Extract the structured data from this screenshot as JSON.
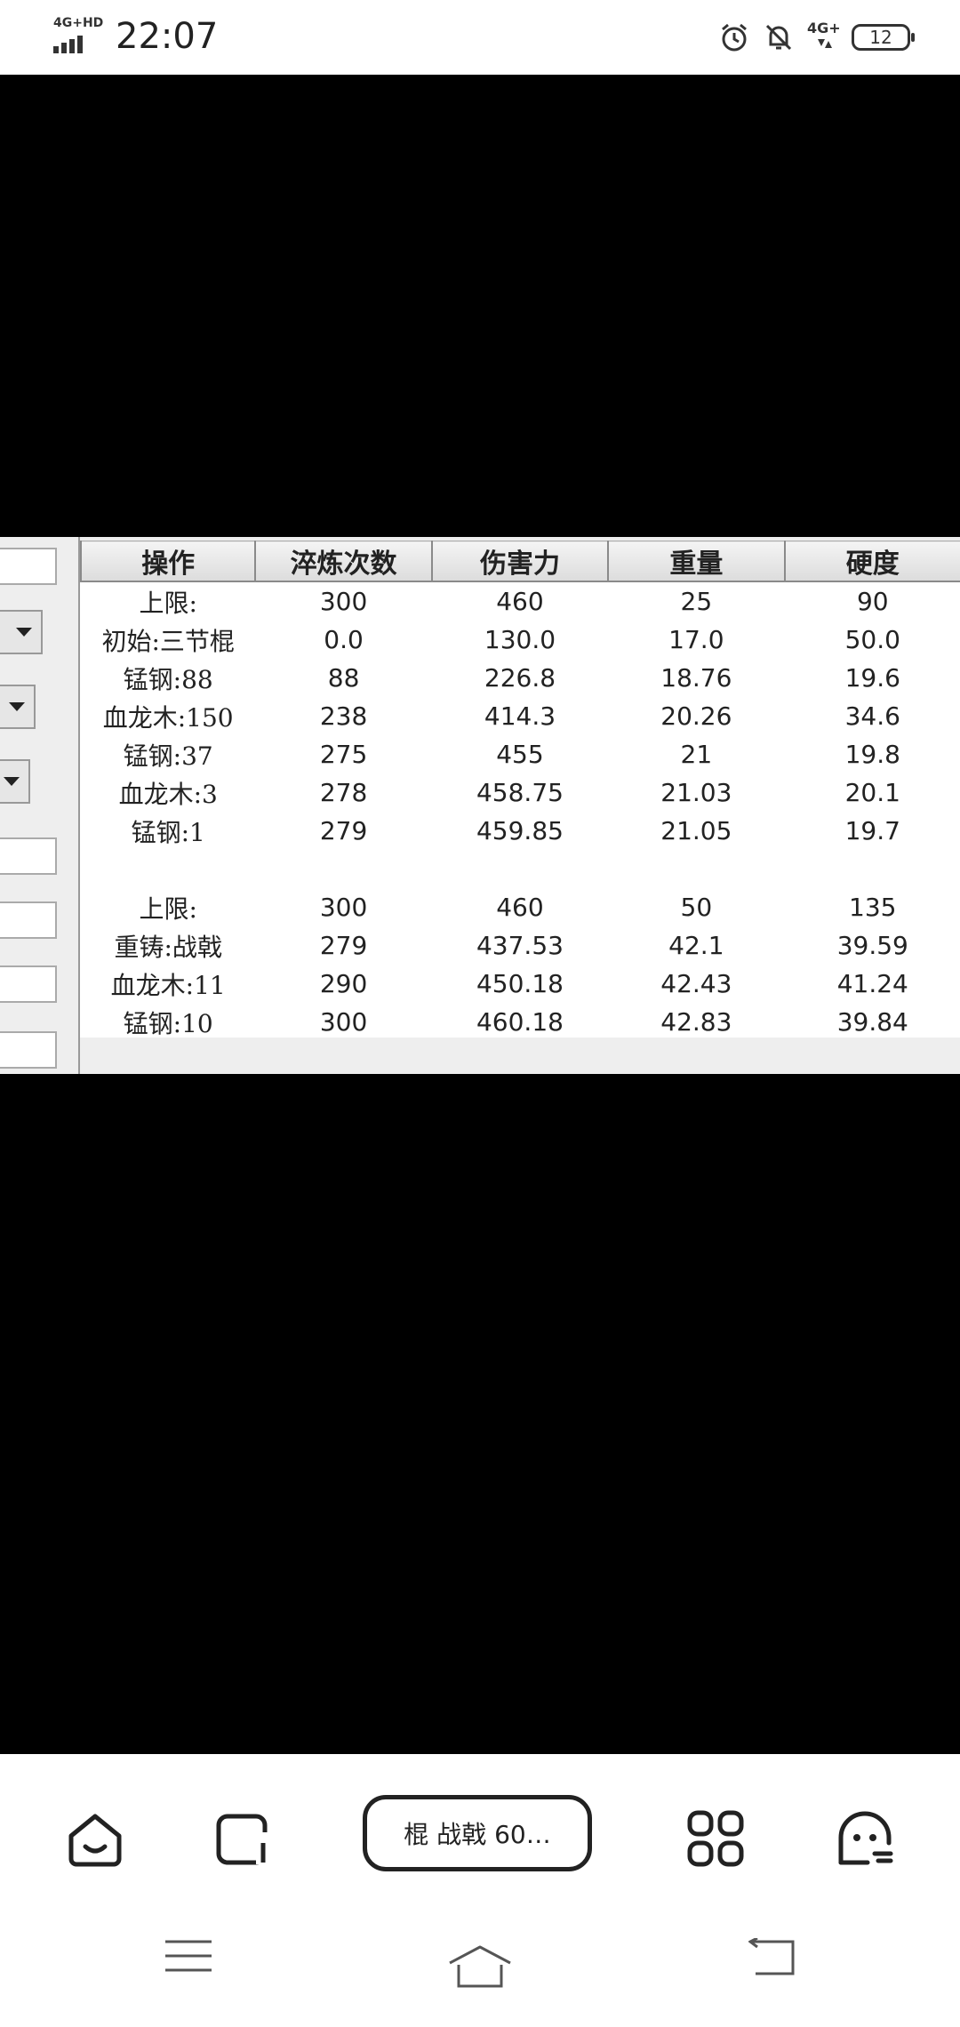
{
  "status_bar": {
    "network": "4G+HD",
    "time": "22:07",
    "network_right": "4G+",
    "battery": "12",
    "icons": [
      "signal-icon",
      "alarm-icon",
      "bell-off-icon",
      "mobile-data-icon",
      "battery-icon"
    ]
  },
  "table": {
    "headers": [
      "操作",
      "淬炼次数",
      "伤害力",
      "重量",
      "硬度"
    ],
    "rows": [
      [
        "上限:",
        "300",
        "460",
        "25",
        "90"
      ],
      [
        "初始:三节棍",
        "0.0",
        "130.0",
        "17.0",
        "50.0"
      ],
      [
        "锰钢:88",
        "88",
        "226.8",
        "18.76",
        "19.6"
      ],
      [
        "血龙木:150",
        "238",
        "414.3",
        "20.26",
        "34.6"
      ],
      [
        "锰钢:37",
        "275",
        "455",
        "21",
        "19.8"
      ],
      [
        "血龙木:3",
        "278",
        "458.75",
        "21.03",
        "20.1"
      ],
      [
        "锰钢:1",
        "279",
        "459.85",
        "21.05",
        "19.7"
      ],
      [
        "",
        "",
        "",
        "",
        ""
      ],
      [
        "上限:",
        "300",
        "460",
        "50",
        "135"
      ],
      [
        "重铸:战戟",
        "279",
        "437.53",
        "42.1",
        "39.59"
      ],
      [
        "血龙木:11",
        "290",
        "450.18",
        "42.43",
        "41.24"
      ],
      [
        "锰钢:10",
        "300",
        "460.18",
        "42.83",
        "39.84"
      ]
    ]
  },
  "bottom_bar": {
    "pill_label": "棍 战戟 60…",
    "icons": [
      "home-smile-icon",
      "tabs-icon",
      "apps-grid-icon",
      "assistant-icon"
    ]
  },
  "nav": {
    "icons": [
      "menu-icon",
      "home-icon",
      "back-icon"
    ]
  }
}
